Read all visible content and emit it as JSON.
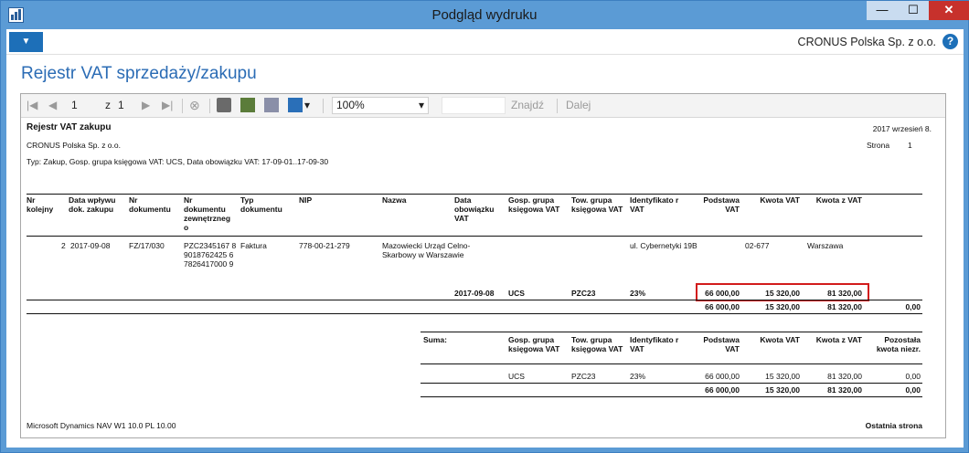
{
  "window": {
    "title": "Podgląd wydruku",
    "min_label": "—",
    "max_label": "☐",
    "close_label": "✕"
  },
  "menu": {
    "dropdown_label": "▼",
    "company": "CRONUS Polska Sp. z o.o.",
    "help_label": "?"
  },
  "page_title": "Rejestr VAT sprzedaży/zakupu",
  "toolbar": {
    "page_value": "1",
    "page_of_label": "z",
    "page_total": "1",
    "zoom_value": "100%",
    "find_label": "Znajdź",
    "next_label": "Dalej",
    "first_glyph": "|◀",
    "prev_glyph": "◀",
    "next_glyph": "▶",
    "last_glyph": "▶|",
    "stop_glyph": "⊗",
    "dropdown_glyph": "▾"
  },
  "report": {
    "title": "Rejestr VAT zakupu",
    "date": "2017 wrzesień 8.",
    "company": "CRONUS Polska Sp. z o.o.",
    "page_label": "Strona",
    "page_number": "1",
    "filter": "Typ: Zakup, Gosp. grupa księgowa VAT: UCS, Data obowiązku VAT: 17-09-01..17-09-30",
    "headers": {
      "nr": "Nr kolejny",
      "data_wplywu": "Data wpływu dok. zakupu",
      "nr_dok": "Nr dokumentu",
      "nr_dok_zewn": "Nr dokumentu zewnętrzneg o",
      "typ": "Typ dokumentu",
      "nip": "NIP",
      "nazwa": "Nazwa",
      "data_obow": "Data obowiązku VAT",
      "gosp": "Gosp. grupa księgowa VAT",
      "tow": "Tow. grupa księgowa VAT",
      "ident": "Identyfikato r VAT",
      "podstawa": "Podstawa VAT",
      "kwota": "Kwota VAT",
      "kwota_z": "Kwota z VAT"
    },
    "row": {
      "nr": "2",
      "data_wplywu": "2017-09-08",
      "nr_dok": "FZ/17/030",
      "nr_dok_zewn": "PZC2345167 89018762425 67826417000 9",
      "typ": "Faktura",
      "nip": "778-00-21-279",
      "nazwa": "Mazowiecki Urząd Celno-Skarbowy w Warszawie",
      "adres": "ul. Cybernetyki 19B",
      "kod": "02-677",
      "miasto": "Warszawa"
    },
    "vat_line": {
      "data": "2017-09-08",
      "gosp": "UCS",
      "tow": "PZC23",
      "ident": "23%",
      "podstawa": "66 000,00",
      "kwota": "15 320,00",
      "kwota_z": "81 320,00"
    },
    "total_line": {
      "podstawa": "66 000,00",
      "kwota": "15 320,00",
      "kwota_z": "81 320,00",
      "pozostala": "0,00"
    },
    "summary": {
      "label": "Suma:",
      "headers": {
        "gosp": "Gosp. grupa księgowa VAT",
        "tow": "Tow. grupa księgowa VAT",
        "ident": "Identyfikato r VAT",
        "podstawa": "Podstawa VAT",
        "kwota": "Kwota VAT",
        "kwota_z": "Kwota z VAT",
        "pozostala": "Pozostała kwota niezr."
      },
      "row": {
        "gosp": "UCS",
        "tow": "PZC23",
        "ident": "23%",
        "podstawa": "66 000,00",
        "kwota": "15 320,00",
        "kwota_z": "81 320,00",
        "pozostala": "0,00"
      },
      "total": {
        "podstawa": "66 000,00",
        "kwota": "15 320,00",
        "kwota_z": "81 320,00",
        "pozostala": "0,00"
      }
    },
    "footer_left": "Microsoft Dynamics NAV W1 10.0  PL 10.00",
    "footer_right": "Ostatnia strona"
  }
}
